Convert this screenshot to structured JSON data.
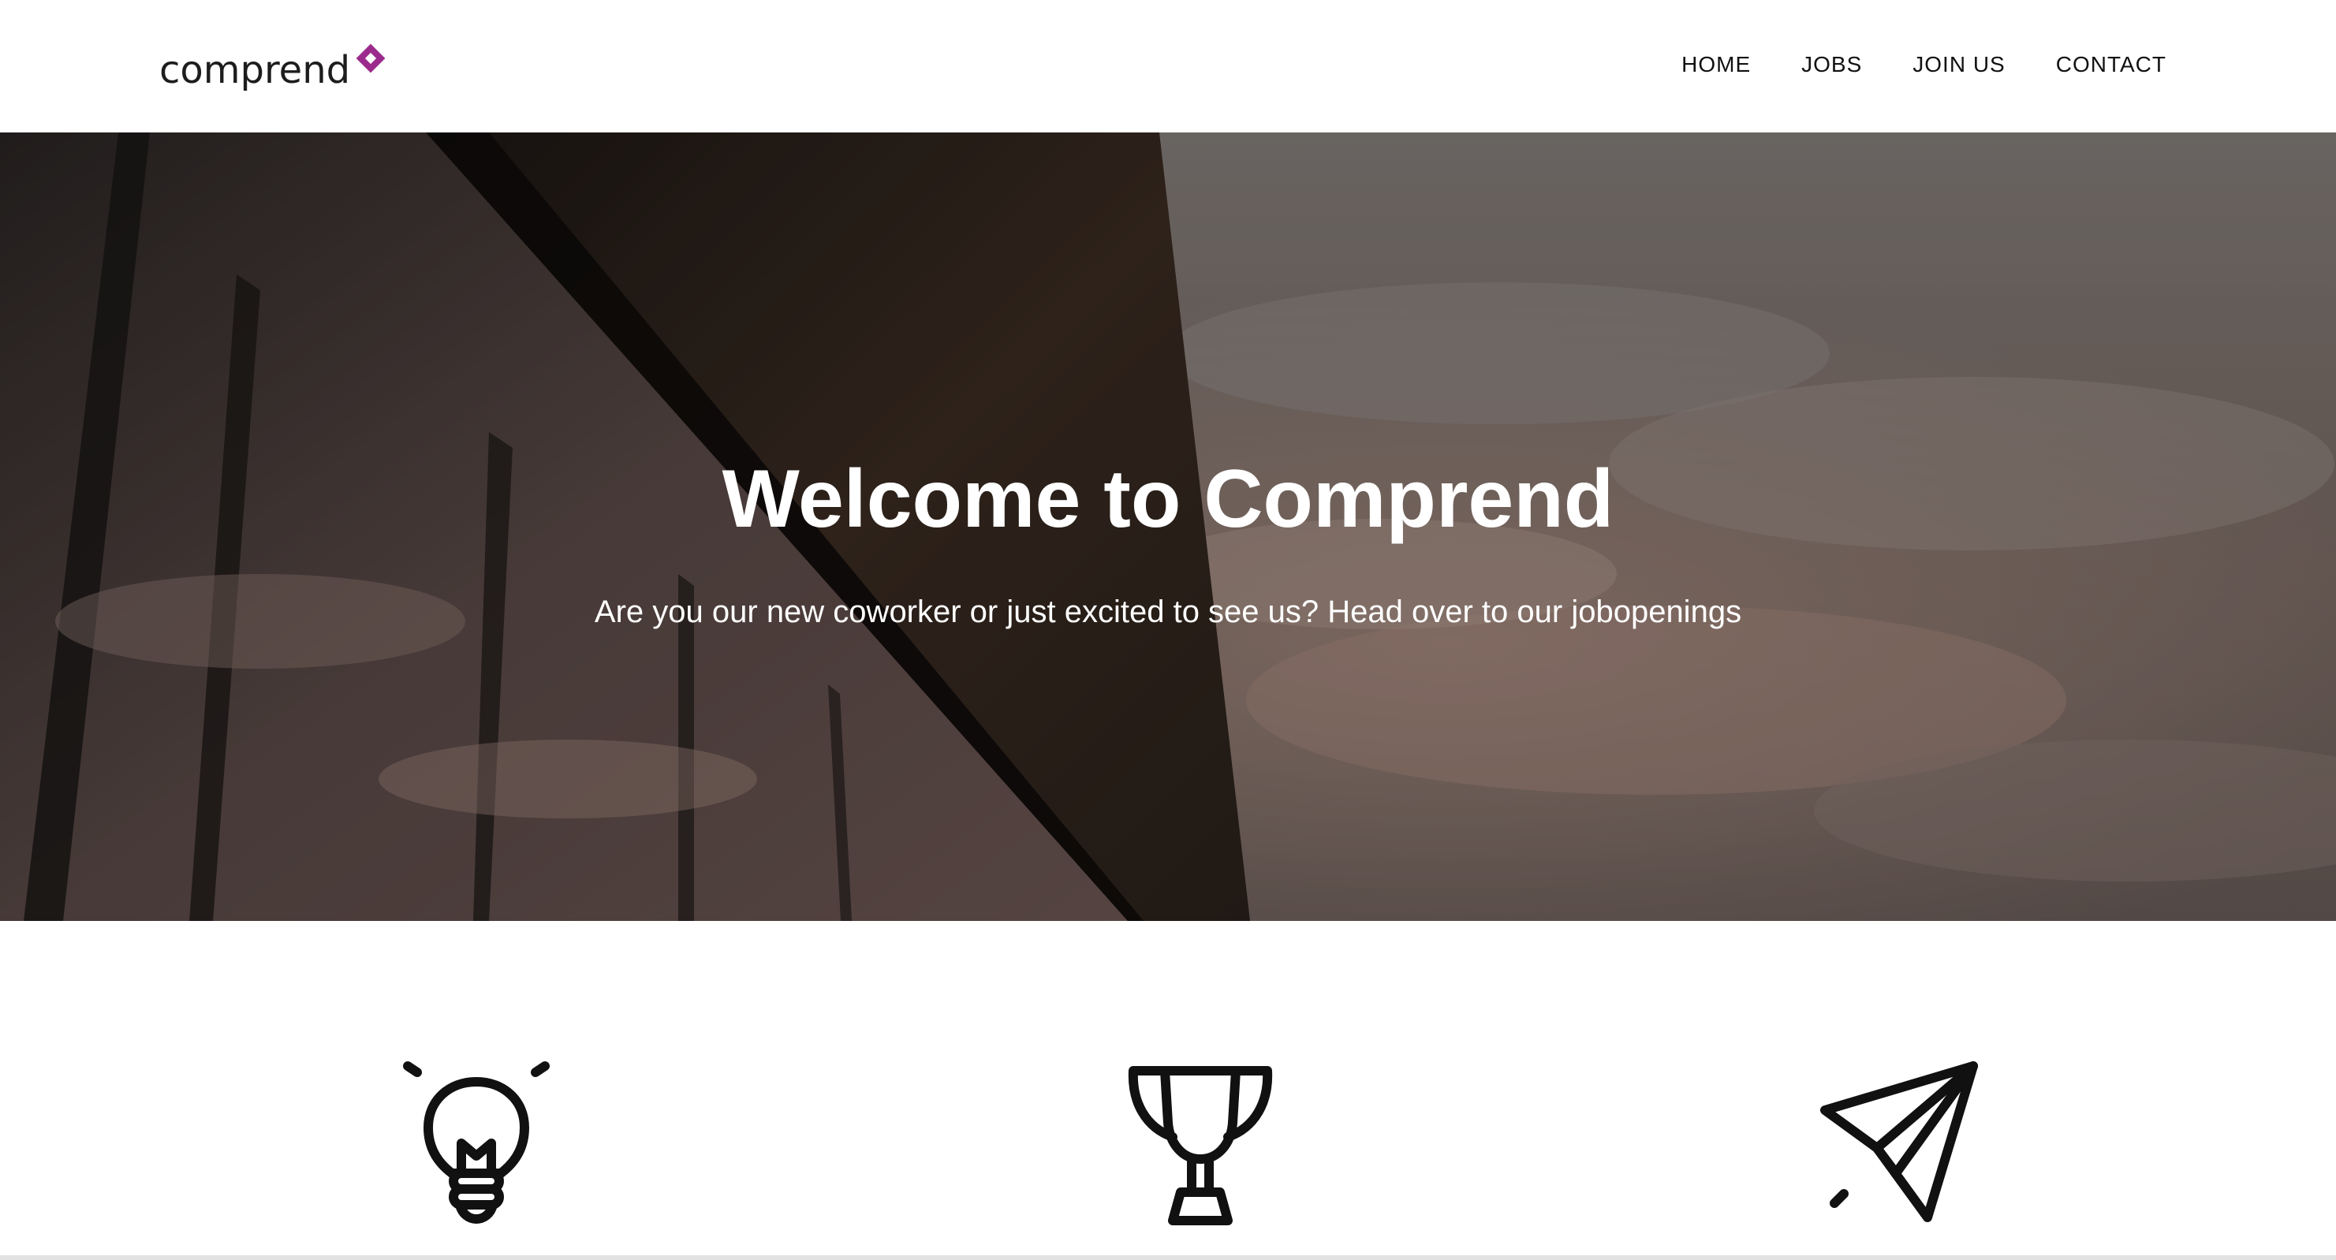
{
  "header": {
    "logo_text": "comprend",
    "logo_icon": "diamond-logo-mark",
    "nav": [
      {
        "label": "HOME"
      },
      {
        "label": "JOBS"
      },
      {
        "label": "JOIN US"
      },
      {
        "label": "CONTACT"
      }
    ]
  },
  "hero": {
    "title": "Welcome to Comprend",
    "subtitle": "Are you our new coworker or just excited to see us? Head over to our jobopenings"
  },
  "features": {
    "icons": [
      "lightbulb-icon",
      "trophy-icon",
      "paper-plane-icon"
    ]
  },
  "colors": {
    "brand_accent": "#9b2a8c",
    "text_dark": "#111111",
    "hero_text": "#ffffff"
  }
}
